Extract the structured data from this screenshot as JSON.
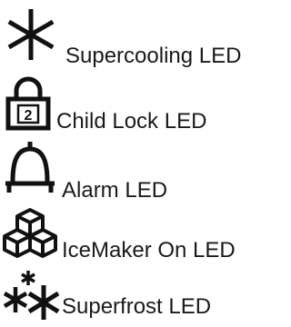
{
  "legend": {
    "items": [
      {
        "icon": "asterisk-icon",
        "label": "Supercooling LED"
      },
      {
        "icon": "padlock-icon",
        "label": "Child Lock LED"
      },
      {
        "icon": "bell-icon",
        "label": "Alarm LED"
      },
      {
        "icon": "ice-cubes-icon",
        "label": "IceMaker On LED"
      },
      {
        "icon": "double-asterisk-icon",
        "label": "Superfrost LED"
      }
    ]
  },
  "colors": {
    "text": "#1a1a1a",
    "icon": "#111111",
    "background": "#ffffff"
  }
}
